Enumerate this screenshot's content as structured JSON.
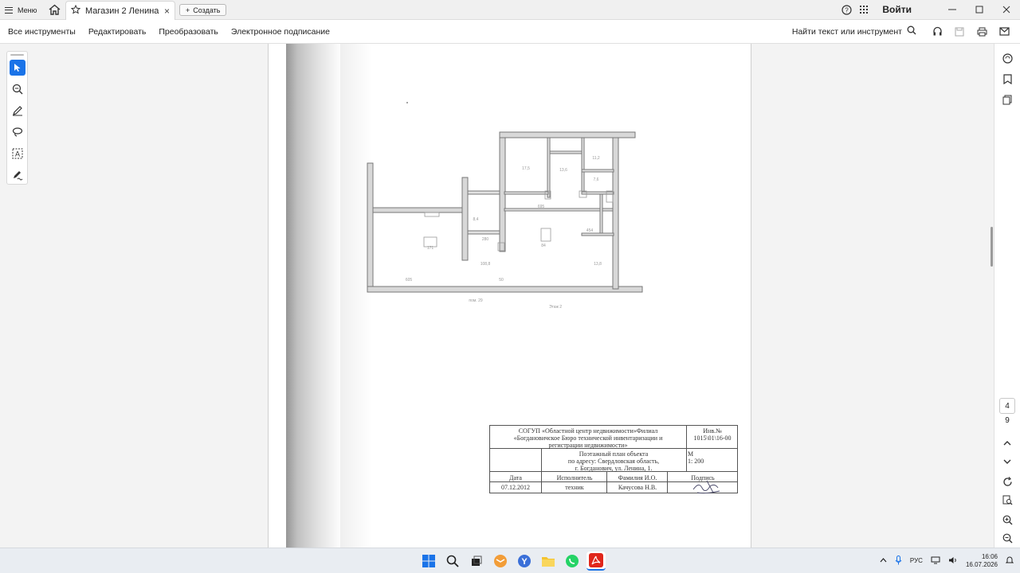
{
  "titlebar": {
    "menu_label": "Меню",
    "tab_title": "Магазин 2 Ленина,...",
    "tab_close": "×",
    "new_label": "Создать",
    "login_label": "Войти",
    "icons": [
      "help-icon",
      "apps-grid-icon",
      "minimize-icon",
      "maximize-icon",
      "close-icon"
    ]
  },
  "toolbar": {
    "items": [
      "Все инструменты",
      "Редактировать",
      "Преобразовать",
      "Электронное подписание"
    ],
    "find_label": "Найти текст или инструмент"
  },
  "left_tools": [
    "select-cursor-icon",
    "zoom-comment-icon",
    "pen-icon",
    "lasso-icon",
    "text-box-icon",
    "sign-icon"
  ],
  "stamp": {
    "org_line1": "СОГУП «Областной центр недвижимости»Филиал",
    "org_line2": "«Богдановичское Бюро технической инвентаризации и",
    "org_line3": "регистрации недвижимости»",
    "inv_label": "Инв.№",
    "inv_value": "1015\\01\\16-00",
    "doc_line1": "Поэтажный план объекта",
    "doc_line2": "по адресу: Свердловская область,",
    "doc_line3": "г. Богданович, ул. Ленина, 1.",
    "scale_label": "М",
    "scale_value": "1: 200",
    "date_label": "Дата",
    "date_value": "07.12.2012",
    "executor_label": "Исполнитель",
    "executor_value": "техник",
    "name_label": "Фамилия И.О.",
    "name_value": "Качусова Н.В.",
    "signature_label": "Подпись"
  },
  "page_nav": {
    "current": "4",
    "total": "9"
  },
  "taskbar": {
    "lang": "РУС",
    "time": "16:06",
    "date": "16.07.2026"
  },
  "colors": {
    "accent": "#1a73e8",
    "acrobat_red": "#e0261b"
  }
}
